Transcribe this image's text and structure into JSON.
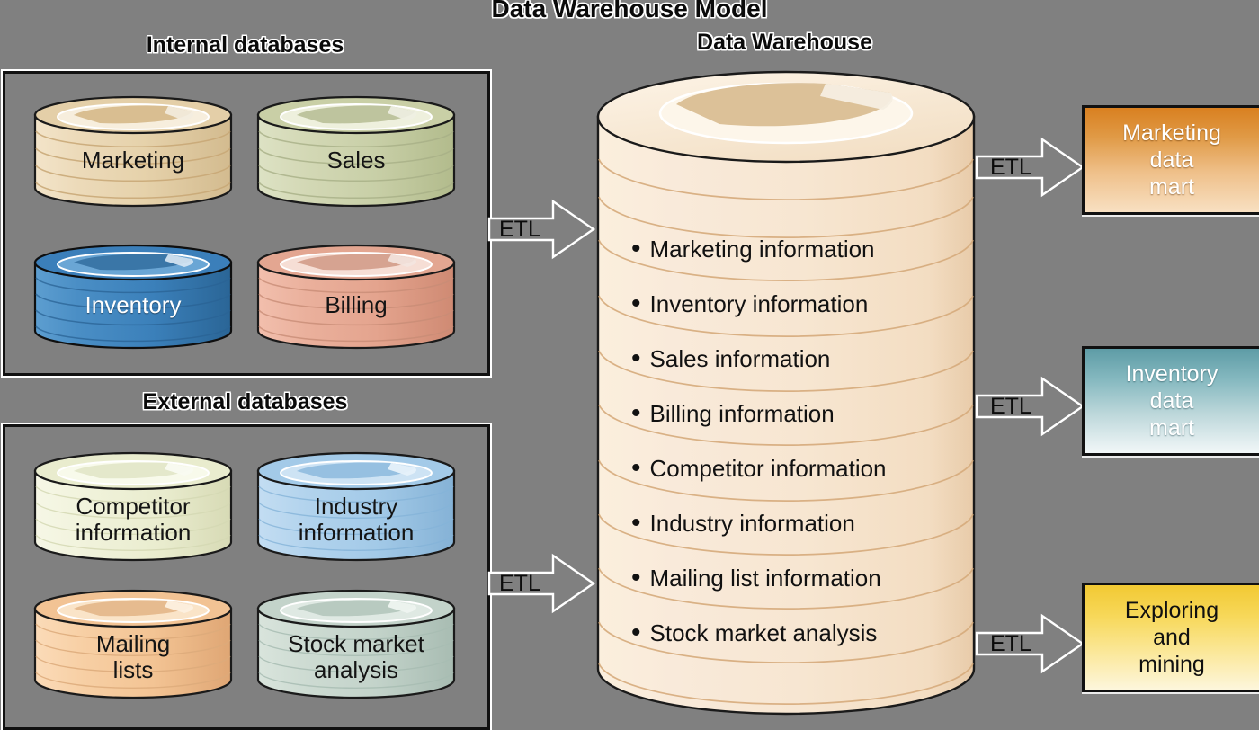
{
  "title": "Data Warehouse Model",
  "background_color": "#808080",
  "sections": {
    "internal": {
      "title": "Internal databases"
    },
    "external": {
      "title": "External databases"
    },
    "warehouse": {
      "title": "Data Warehouse"
    }
  },
  "internal_databases": [
    {
      "label": "Marketing",
      "color": "#e9d6b4",
      "text_color": "#141414"
    },
    {
      "label": "Sales",
      "color": "#cbd2ae",
      "text_color": "#141414"
    },
    {
      "label": "Inventory",
      "color": "#3d80bb",
      "text_color": "#ffffff"
    },
    {
      "label": "Billing",
      "color": "#e6a893",
      "text_color": "#141414"
    }
  ],
  "external_databases": [
    {
      "label": "Competitor\ninformation",
      "color": "#eef0d6",
      "text_color": "#141414"
    },
    {
      "label": "Industry\ninformation",
      "color": "#a9cde9",
      "text_color": "#141414"
    },
    {
      "label": "Mailing\nlists",
      "color": "#f4c79b",
      "text_color": "#141414"
    },
    {
      "label": "Stock market\nanalysis",
      "color": "#c6d6cd",
      "text_color": "#141414"
    }
  ],
  "warehouse": {
    "color": "#f6e3c8",
    "items": [
      "Marketing information",
      "Inventory information",
      "Sales information",
      "Billing information",
      "Competitor information",
      "Industry information",
      "Mailing list information",
      "Stock market analysis"
    ]
  },
  "arrows": {
    "internal_to_warehouse": "ETL",
    "external_to_warehouse": "ETL",
    "warehouse_to_marketing": "ETL",
    "warehouse_to_inventory": "ETL",
    "warehouse_to_mining": "ETL"
  },
  "data_marts": [
    {
      "label": "Marketing\ndata\nmart",
      "accent": "#d98020",
      "text_color": "#ffffff"
    },
    {
      "label": "Inventory\ndata\nmart",
      "accent": "#5e9ca6",
      "text_color": "#ffffff"
    },
    {
      "label": "Exploring\nand\nmining",
      "accent": "#f2c933",
      "text_color": "#101010"
    }
  ]
}
